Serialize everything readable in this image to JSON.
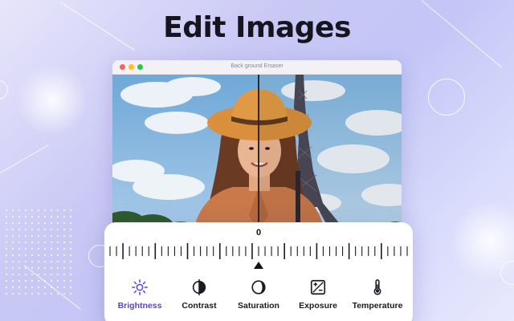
{
  "headline": "Edit Images",
  "window": {
    "title": "Back ground Ersaser"
  },
  "adjustment": {
    "value": "0"
  },
  "tools": [
    {
      "label": "Brightness",
      "icon": "sun-icon",
      "active": true
    },
    {
      "label": "Contrast",
      "icon": "contrast-icon",
      "active": false
    },
    {
      "label": "Saturation",
      "icon": "saturation-icon",
      "active": false
    },
    {
      "label": "Exposure",
      "icon": "exposure-icon",
      "active": false
    },
    {
      "label": "Temperature",
      "icon": "thermometer-icon",
      "active": false
    }
  ],
  "colors": {
    "accent": "#5b3fe3",
    "text": "#16141f",
    "background": "#c9c8f5"
  }
}
